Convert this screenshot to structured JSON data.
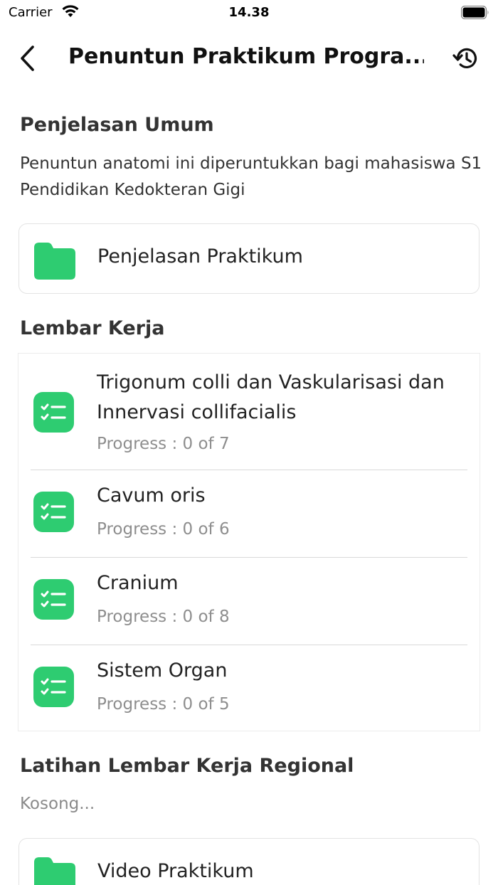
{
  "status_bar": {
    "carrier": "Carrier",
    "time": "14.38"
  },
  "nav": {
    "title": "Penuntun Praktikum Progra..."
  },
  "general": {
    "heading": "Penjelasan Umum",
    "description": "Penuntun anatomi ini diperuntukkan bagi mahasiswa S1 Pendidikan Kedokteran Gigi",
    "folder_label": "Penjelasan Praktikum"
  },
  "worksheets": {
    "heading": "Lembar Kerja",
    "items": [
      {
        "title": "Trigonum colli dan Vaskularisasi dan Innervasi collifacialis",
        "progress": "Progress : 0 of 7"
      },
      {
        "title": "Cavum oris",
        "progress": "Progress : 0 of 6"
      },
      {
        "title": "Cranium",
        "progress": "Progress : 0 of 8"
      },
      {
        "title": "Sistem Organ",
        "progress": "Progress : 0 of 5"
      }
    ]
  },
  "regional": {
    "heading": "Latihan Lembar Kerja Regional",
    "empty_text": "Kosong..."
  },
  "video": {
    "folder_label": "Video Praktikum"
  },
  "colors": {
    "accent": "#2ecc71"
  },
  "icons": {
    "back": "chevron-left-icon",
    "history": "history-icon",
    "folder": "folder-icon",
    "task": "checklist-icon"
  }
}
